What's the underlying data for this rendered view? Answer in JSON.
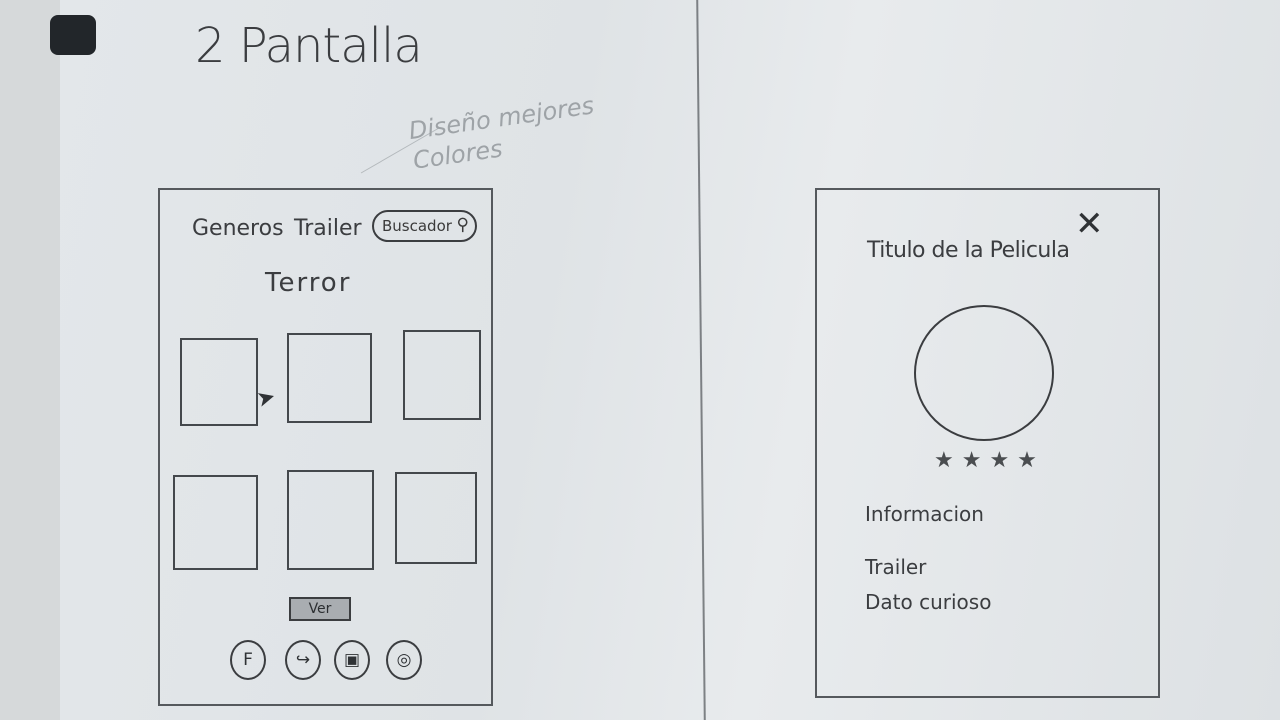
{
  "sketch_heading": "2 Pantalla",
  "side_note": "Diseño mejores Colores",
  "list_screen": {
    "nav": {
      "generos_label": "Generos",
      "trailer_label": "Trailer",
      "search_label": "Buscador",
      "search_icon": "search-icon"
    },
    "genre_title": "Terror",
    "thumbnails_count": 6,
    "ver_button_label": "Ver",
    "social_icons": [
      {
        "name": "facebook-icon",
        "glyph": "F"
      },
      {
        "name": "share-icon",
        "glyph": "↪"
      },
      {
        "name": "video-icon",
        "glyph": "▣"
      },
      {
        "name": "instagram-icon",
        "glyph": "◎"
      }
    ]
  },
  "detail_screen": {
    "close_glyph": "✕",
    "movie_title": "Titulo de la Pelicula",
    "rating": {
      "stars": 4,
      "glyph": "★★★★"
    },
    "info_label": "Informacion",
    "trailer_label": "Trailer",
    "fun_fact_label": "Dato curioso"
  }
}
